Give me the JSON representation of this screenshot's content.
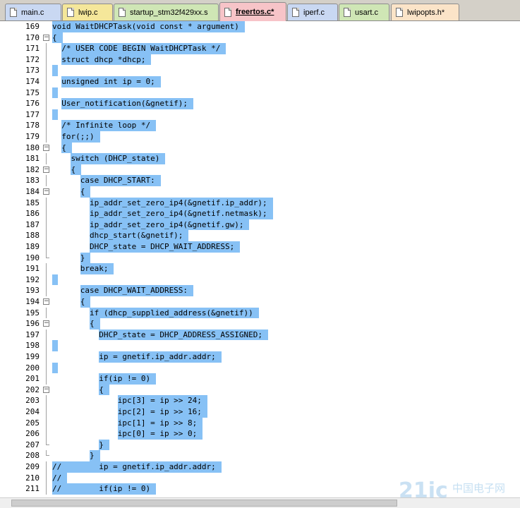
{
  "tabs": [
    {
      "label": "main.c",
      "color": "#c9d8f2",
      "active": false
    },
    {
      "label": "lwip.c",
      "color": "#f5e79a",
      "active": false
    },
    {
      "label": "startup_stm32f429xx.s",
      "color": "#cfe6b5",
      "active": false
    },
    {
      "label": "freertos.c*",
      "color": "#f7c4c8",
      "active": true
    },
    {
      "label": "iperf.c",
      "color": "#c9d8f2",
      "active": false
    },
    {
      "label": "usart.c",
      "color": "#cfe6b5",
      "active": false
    },
    {
      "label": "lwipopts.h*",
      "color": "#fbe4c8",
      "active": false
    }
  ],
  "editor": {
    "selection_color": "#87c1f5",
    "lines": [
      {
        "n": "169",
        "text": "void WaitDHCPTask(void const * argument)",
        "fold": ""
      },
      {
        "n": "170",
        "text": "{",
        "fold": "open"
      },
      {
        "n": "171",
        "text": "  /* USER CODE BEGIN WaitDHCPTask */",
        "fold": "line"
      },
      {
        "n": "172",
        "text": "  struct dhcp *dhcp;",
        "fold": "line"
      },
      {
        "n": "173",
        "text": "",
        "fold": "line"
      },
      {
        "n": "174",
        "text": "  unsigned int ip = 0;",
        "fold": "line"
      },
      {
        "n": "175",
        "text": "",
        "fold": "line"
      },
      {
        "n": "176",
        "text": "  User_notification(&gnetif);",
        "fold": "line"
      },
      {
        "n": "177",
        "text": "",
        "fold": "line"
      },
      {
        "n": "178",
        "text": "  /* Infinite loop */",
        "fold": "line"
      },
      {
        "n": "179",
        "text": "  for(;;)",
        "fold": "line"
      },
      {
        "n": "180",
        "text": "  {",
        "fold": "open"
      },
      {
        "n": "181",
        "text": "    switch (DHCP_state)",
        "fold": "line"
      },
      {
        "n": "182",
        "text": "    {",
        "fold": "open"
      },
      {
        "n": "183",
        "text": "      case DHCP_START:",
        "fold": "line"
      },
      {
        "n": "184",
        "text": "      {",
        "fold": "open"
      },
      {
        "n": "185",
        "text": "        ip_addr_set_zero_ip4(&gnetif.ip_addr);",
        "fold": "line"
      },
      {
        "n": "186",
        "text": "        ip_addr_set_zero_ip4(&gnetif.netmask);",
        "fold": "line"
      },
      {
        "n": "187",
        "text": "        ip_addr_set_zero_ip4(&gnetif.gw);",
        "fold": "line"
      },
      {
        "n": "188",
        "text": "        dhcp_start(&gnetif);",
        "fold": "line"
      },
      {
        "n": "189",
        "text": "        DHCP_state = DHCP_WAIT_ADDRESS;",
        "fold": "line"
      },
      {
        "n": "190",
        "text": "      }",
        "fold": "end"
      },
      {
        "n": "191",
        "text": "      break;",
        "fold": "line"
      },
      {
        "n": "192",
        "text": "",
        "fold": "line"
      },
      {
        "n": "193",
        "text": "      case DHCP_WAIT_ADDRESS:",
        "fold": "line"
      },
      {
        "n": "194",
        "text": "      {",
        "fold": "open"
      },
      {
        "n": "195",
        "text": "        if (dhcp_supplied_address(&gnetif))",
        "fold": "line"
      },
      {
        "n": "196",
        "text": "        {",
        "fold": "open"
      },
      {
        "n": "197",
        "text": "          DHCP_state = DHCP_ADDRESS_ASSIGNED;",
        "fold": "line"
      },
      {
        "n": "198",
        "text": "",
        "fold": "line"
      },
      {
        "n": "199",
        "text": "          ip = gnetif.ip_addr.addr;",
        "fold": "line"
      },
      {
        "n": "200",
        "text": "",
        "fold": "line"
      },
      {
        "n": "201",
        "text": "          if(ip != 0)",
        "fold": "line"
      },
      {
        "n": "202",
        "text": "          {",
        "fold": "open"
      },
      {
        "n": "203",
        "text": "              ipc[3] = ip >> 24;",
        "fold": "line"
      },
      {
        "n": "204",
        "text": "              ipc[2] = ip >> 16;",
        "fold": "line"
      },
      {
        "n": "205",
        "text": "              ipc[1] = ip >> 8;",
        "fold": "line"
      },
      {
        "n": "206",
        "text": "              ipc[0] = ip >> 0;",
        "fold": "line"
      },
      {
        "n": "207",
        "text": "          }",
        "fold": "end"
      },
      {
        "n": "208",
        "text": "        }",
        "fold": "end"
      },
      {
        "n": "209",
        "text": "//        ip = gnetif.ip_addr.addr;",
        "fold": "line"
      },
      {
        "n": "210",
        "text": "//",
        "fold": "line"
      },
      {
        "n": "211",
        "text": "//        if(ip != 0)",
        "fold": "line"
      }
    ]
  },
  "watermark": {
    "text": "21ic",
    "subtext": "中国电子网"
  }
}
